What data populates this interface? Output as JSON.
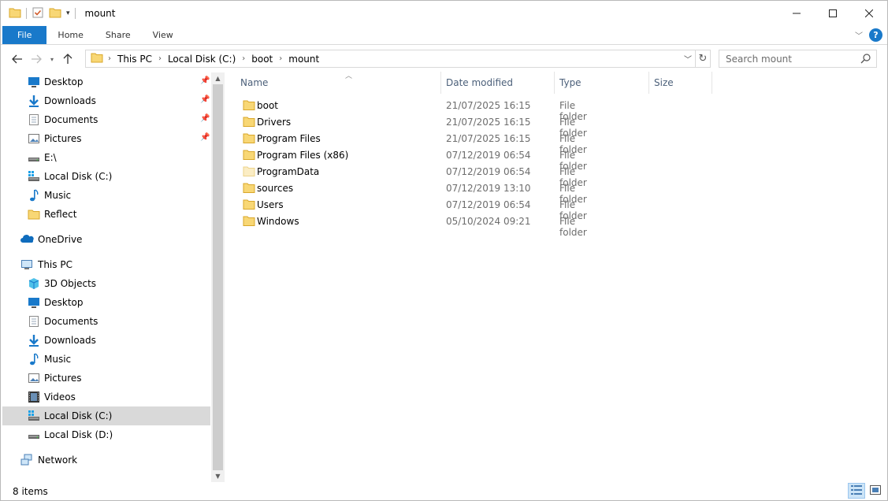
{
  "window": {
    "title": "mount",
    "controls": {
      "minimize": "—",
      "maximize": "☐",
      "close": "✕"
    }
  },
  "ribbon": {
    "tabs": [
      "File",
      "Home",
      "Share",
      "View"
    ]
  },
  "address": {
    "crumbs": [
      "This PC",
      "Local Disk (C:)",
      "boot",
      "mount"
    ],
    "search_placeholder": "Search mount"
  },
  "sidebar": {
    "quick_access": [
      {
        "label": "Desktop",
        "icon": "desktop-icon",
        "pinned": true
      },
      {
        "label": "Downloads",
        "icon": "downloads-icon",
        "pinned": true
      },
      {
        "label": "Documents",
        "icon": "documents-icon",
        "pinned": true
      },
      {
        "label": "Pictures",
        "icon": "pictures-icon",
        "pinned": true
      },
      {
        "label": "E:\\",
        "icon": "drive-icon",
        "pinned": false
      },
      {
        "label": "Local Disk (C:)",
        "icon": "system-drive-icon",
        "pinned": false
      },
      {
        "label": "Music",
        "icon": "music-icon",
        "pinned": false
      },
      {
        "label": "Reflect",
        "icon": "folder-icon",
        "pinned": false
      }
    ],
    "onedrive": "OneDrive",
    "this_pc": "This PC",
    "this_pc_items": [
      {
        "label": "3D Objects",
        "icon": "3d-objects-icon"
      },
      {
        "label": "Desktop",
        "icon": "desktop-icon"
      },
      {
        "label": "Documents",
        "icon": "documents-icon"
      },
      {
        "label": "Downloads",
        "icon": "downloads-icon"
      },
      {
        "label": "Music",
        "icon": "music-icon"
      },
      {
        "label": "Pictures",
        "icon": "pictures-icon"
      },
      {
        "label": "Videos",
        "icon": "videos-icon"
      },
      {
        "label": "Local Disk (C:)",
        "icon": "system-drive-icon",
        "selected": true
      },
      {
        "label": "Local Disk (D:)",
        "icon": "drive-icon"
      }
    ],
    "network": "Network"
  },
  "columns": [
    "Name",
    "Date modified",
    "Type",
    "Size"
  ],
  "files": [
    {
      "name": "boot",
      "date": "21/07/2025 16:15",
      "type": "File folder"
    },
    {
      "name": "Drivers",
      "date": "21/07/2025 16:15",
      "type": "File folder"
    },
    {
      "name": "Program Files",
      "date": "21/07/2025 16:15",
      "type": "File folder"
    },
    {
      "name": "Program Files (x86)",
      "date": "07/12/2019 06:54",
      "type": "File folder"
    },
    {
      "name": "ProgramData",
      "date": "07/12/2019 06:54",
      "type": "File folder",
      "hidden": true
    },
    {
      "name": "sources",
      "date": "07/12/2019 13:10",
      "type": "File folder"
    },
    {
      "name": "Users",
      "date": "07/12/2019 06:54",
      "type": "File folder"
    },
    {
      "name": "Windows",
      "date": "05/10/2024 09:21",
      "type": "File folder"
    }
  ],
  "status": {
    "item_count": "8 items"
  },
  "colors": {
    "accent": "#1979ca",
    "folder": "#f8d775",
    "selected": "#d9d9d9"
  }
}
